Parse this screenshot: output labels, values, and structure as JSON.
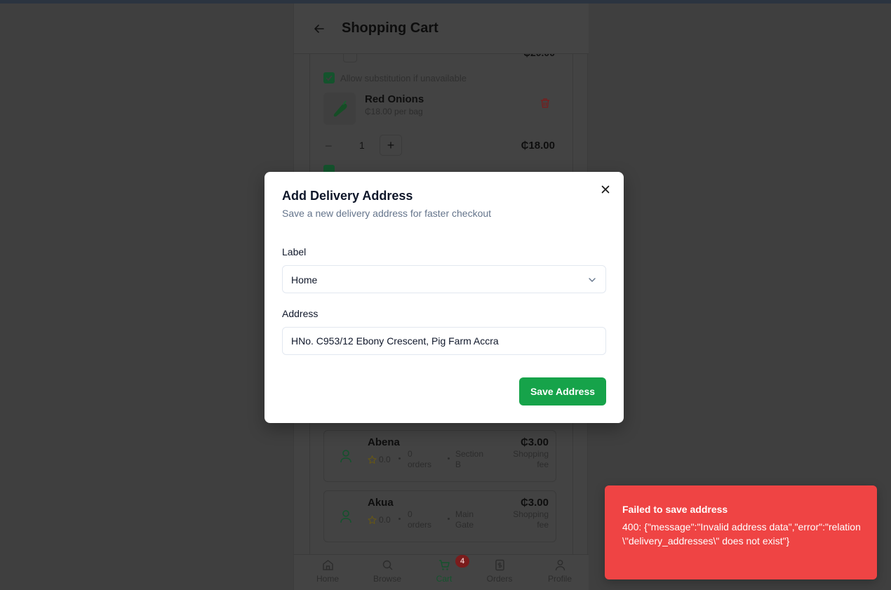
{
  "header": {
    "title": "Shopping Cart"
  },
  "cart": {
    "top_price": "₵20.00",
    "substitution_label": "Allow substitution if unavailable",
    "item": {
      "name": "Red Onions",
      "unit_price": "₵18.00 per bag",
      "quantity": "1",
      "line_total": "₵18.00"
    },
    "shoppers": [
      {
        "name": "Abena",
        "rating": "0.0",
        "orders": "0 orders",
        "location": "Section B",
        "fee": "₵3.00",
        "fee_label": "Shopping fee"
      },
      {
        "name": "Akua",
        "rating": "0.0",
        "orders": "0 orders",
        "location": "Main Gate",
        "fee": "₵3.00",
        "fee_label": "Shopping fee"
      }
    ]
  },
  "nav": {
    "items": [
      {
        "label": "Home",
        "icon": "home-icon"
      },
      {
        "label": "Browse",
        "icon": "search-icon"
      },
      {
        "label": "Cart",
        "icon": "cart-icon"
      },
      {
        "label": "Orders",
        "icon": "receipt-icon"
      },
      {
        "label": "Profile",
        "icon": "user-icon"
      }
    ],
    "cart_badge": "4",
    "active": "Cart"
  },
  "modal": {
    "title": "Add Delivery Address",
    "description": "Save a new delivery address for faster checkout",
    "label_field": {
      "label": "Label",
      "value": "Home"
    },
    "address_field": {
      "label": "Address",
      "value": "HNo. C953/12 Ebony Crescent, Pig Farm Accra"
    },
    "save_label": "Save Address"
  },
  "toast": {
    "title": "Failed to save address",
    "message": "400: {\"message\":\"Invalid address data\",\"error\":\"relation \\\"delivery_addresses\\\" does not exist\"}"
  },
  "colors": {
    "primary": "#16a34a",
    "error": "#ef4444",
    "overlay": "#3f3f3f"
  }
}
